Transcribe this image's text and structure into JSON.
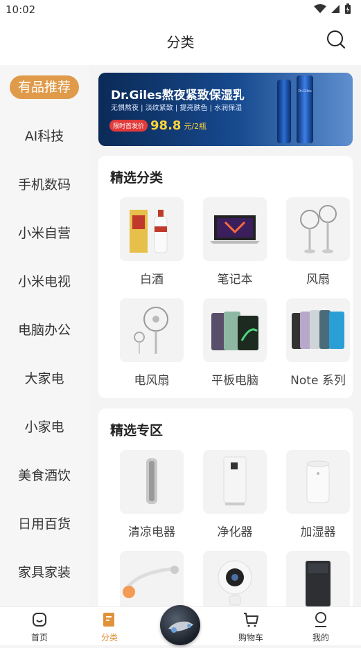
{
  "status": {
    "time": "10:02"
  },
  "header": {
    "title": "分类"
  },
  "sidebar": {
    "items": [
      {
        "label": "有品推荐",
        "active": true
      },
      {
        "label": "AI科技"
      },
      {
        "label": "手机数码"
      },
      {
        "label": "小米自营"
      },
      {
        "label": "小米电视"
      },
      {
        "label": "电脑办公"
      },
      {
        "label": "大家电"
      },
      {
        "label": "小家电"
      },
      {
        "label": "美食酒饮"
      },
      {
        "label": "日用百货"
      },
      {
        "label": "家具家装"
      }
    ]
  },
  "banner": {
    "title": "Dr.Giles熬夜紧致保湿乳",
    "subtitle": "无惧熬夜 | 淡纹紧致 | 提亮肤色 | 水润保湿",
    "price_tag": "限时首发价",
    "price": "98.8",
    "price_unit": "元/2瓶",
    "brand_mark": "Dr.Giles"
  },
  "section1": {
    "title": "精选分类",
    "items": [
      {
        "label": "白酒",
        "icon": "baijiu-bottle-icon"
      },
      {
        "label": "笔记本",
        "icon": "laptop-icon"
      },
      {
        "label": "风扇",
        "icon": "fan-icon"
      },
      {
        "label": "电风扇",
        "icon": "electric-fan-icon"
      },
      {
        "label": "平板电脑",
        "icon": "tablet-icon"
      },
      {
        "label": "Note 系列",
        "icon": "phone-icon"
      }
    ]
  },
  "section2": {
    "title": "精选专区",
    "items": [
      {
        "label": "清凉电器",
        "icon": "tower-fan-icon"
      },
      {
        "label": "净化器",
        "icon": "purifier-icon"
      },
      {
        "label": "加湿器",
        "icon": "humidifier-icon"
      },
      {
        "label": "",
        "icon": "headphones-icon"
      },
      {
        "label": "",
        "icon": "camera-icon"
      },
      {
        "label": "",
        "icon": "washer-icon"
      }
    ]
  },
  "tabbar": {
    "items": [
      {
        "label": "首页",
        "icon": "home-icon"
      },
      {
        "label": "分类",
        "icon": "category-icon",
        "active": true
      },
      {
        "label": "",
        "icon": "scooter-center-icon"
      },
      {
        "label": "购物车",
        "icon": "cart-icon"
      },
      {
        "label": "我的",
        "icon": "profile-icon"
      }
    ]
  },
  "colors": {
    "accent": "#e09b4a",
    "banner_bg": "#174a8f"
  }
}
